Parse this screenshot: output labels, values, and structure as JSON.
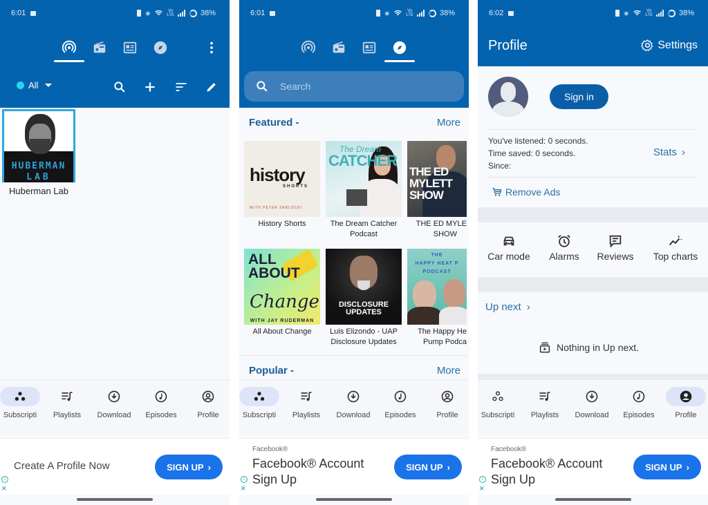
{
  "colors": {
    "primary": "#0463ae",
    "accent_dot": "#2ad4f5",
    "link": "#2c6fa1",
    "ad_button": "#1a73e8",
    "nav_active_pill": "#dde4f7"
  },
  "screens": [
    {
      "status": {
        "time": "6:01",
        "battery": "38%"
      },
      "top_tabs": [
        {
          "icon": "podcast-icon",
          "active": true
        },
        {
          "icon": "radio-icon",
          "active": false
        },
        {
          "icon": "news-icon",
          "active": false
        },
        {
          "icon": "compass-icon",
          "active": false
        }
      ],
      "filter": {
        "label": "All"
      },
      "subscriptions": [
        {
          "title": "Huberman Lab",
          "cover_line1": "HUBERMAN",
          "cover_line2": "LAB"
        }
      ],
      "bottom_nav": [
        {
          "label": "Subscripti",
          "icon": "subscriptions-icon",
          "active": true
        },
        {
          "label": "Playlists",
          "icon": "playlists-icon",
          "active": false
        },
        {
          "label": "Download",
          "icon": "download-icon",
          "active": false
        },
        {
          "label": "Episodes",
          "icon": "episodes-icon",
          "active": false
        },
        {
          "label": "Profile",
          "icon": "profile-icon",
          "active": false
        }
      ],
      "ad": {
        "text": "Create A Profile Now",
        "button": "SIGN UP"
      }
    },
    {
      "status": {
        "time": "6:01",
        "battery": "38%"
      },
      "top_tabs": [
        {
          "icon": "podcast-icon",
          "active": false
        },
        {
          "icon": "radio-icon",
          "active": false
        },
        {
          "icon": "news-icon",
          "active": false
        },
        {
          "icon": "compass-icon",
          "active": true
        }
      ],
      "search": {
        "placeholder": "Search",
        "value": ""
      },
      "featured": {
        "title": "Featured -",
        "more": "More",
        "rows": [
          [
            {
              "title": "History Shorts",
              "art_text": "history",
              "art_sub": "SHORTS",
              "art_with": "WITH PETER ZABLOCKI"
            },
            {
              "title": "The Dream Catcher Podcast",
              "title_l1": "The Dream Catcher",
              "title_l2": "Podcast",
              "art_text1": "The Dream",
              "art_text2": "CATCHER"
            },
            {
              "title": "THE ED MYLETT SHOW",
              "title_l1": "THE ED MYLE",
              "title_l2": "SHOW",
              "art_text": "THE ED MYLETT SHOW"
            }
          ],
          [
            {
              "title": "All About Change",
              "art_text": "ALL ABOUT",
              "art_script": "Change",
              "art_with": "WITH JAY RUDERMAN"
            },
            {
              "title": "Luis Elizondo - UAP Disclosure Updates",
              "title_l1": "Luis Elizondo - UAP",
              "title_l2": "Disclosure Updates",
              "art_text1": "DISCLOSURE",
              "art_text2": "UPDATES"
            },
            {
              "title": "The Happy Heat Pump Podcast",
              "title_l1": "The Happy He",
              "title_l2": "Pump Podca",
              "art_text1": "THE",
              "art_text2": "HAPPY HEAT P",
              "art_text3": "PODCAST"
            }
          ]
        ]
      },
      "popular": {
        "title": "Popular -",
        "more": "More"
      },
      "bottom_nav": [
        {
          "label": "Subscripti",
          "icon": "subscriptions-icon",
          "active": true
        },
        {
          "label": "Playlists",
          "icon": "playlists-icon",
          "active": false
        },
        {
          "label": "Download",
          "icon": "download-icon",
          "active": false
        },
        {
          "label": "Episodes",
          "icon": "episodes-icon",
          "active": false
        },
        {
          "label": "Profile",
          "icon": "profile-icon",
          "active": false
        }
      ],
      "ad": {
        "brand": "Facebook®",
        "headline": "Facebook® Account Sign Up",
        "button": "SIGN UP"
      }
    },
    {
      "status": {
        "time": "6:02",
        "battery": "38%"
      },
      "header": {
        "title": "Profile",
        "settings": "Settings"
      },
      "signin": "Sign in",
      "stats": {
        "listened": "You've listened: 0 seconds.",
        "saved": "Time saved: 0 seconds.",
        "since": "Since:",
        "link": "Stats"
      },
      "remove_ads": "Remove Ads",
      "quick_actions": [
        {
          "label": "Car mode",
          "icon": "car-icon"
        },
        {
          "label": "Alarms",
          "icon": "alarm-icon"
        },
        {
          "label": "Reviews",
          "icon": "reviews-icon"
        },
        {
          "label": "Top charts",
          "icon": "top-charts-icon"
        }
      ],
      "up_next": {
        "title": "Up next",
        "empty": "Nothing in Up next."
      },
      "bottom_nav": [
        {
          "label": "Subscripti",
          "icon": "subscriptions-icon",
          "active": false
        },
        {
          "label": "Playlists",
          "icon": "playlists-icon",
          "active": false
        },
        {
          "label": "Download",
          "icon": "download-icon",
          "active": false
        },
        {
          "label": "Episodes",
          "icon": "episodes-icon",
          "active": false
        },
        {
          "label": "Profile",
          "icon": "profile-icon",
          "active": true
        }
      ],
      "ad": {
        "brand": "Facebook®",
        "headline": "Facebook® Account Sign Up",
        "button": "SIGN UP"
      }
    }
  ]
}
